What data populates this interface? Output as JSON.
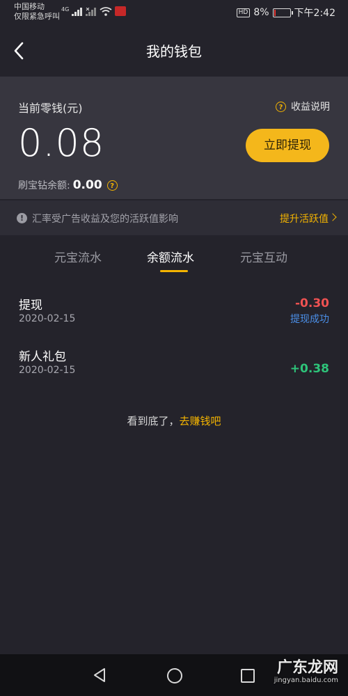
{
  "status_bar": {
    "carrier_line1": "中国移动",
    "carrier_line2": "仅限紧急呼叫",
    "network": "4G",
    "battery_percent": "8%",
    "battery_level": 0.08,
    "time": "下午2:42"
  },
  "header": {
    "title": "我的钱包"
  },
  "wallet": {
    "balance_label": "当前零钱(元)",
    "help_label": "收益说明",
    "balance": "0.08",
    "withdraw_label": "立即提现",
    "diamond_label": "刷宝钻余额:",
    "diamond_value": "0.00"
  },
  "notice": {
    "text": "汇率受广告收益及您的活跃值影响",
    "action": "提升活跃值"
  },
  "tabs": [
    {
      "label": "元宝流水",
      "active": false
    },
    {
      "label": "余额流水",
      "active": true
    },
    {
      "label": "元宝互动",
      "active": false
    }
  ],
  "records": [
    {
      "title": "提现",
      "date": "2020-02-15",
      "amount": "-0.30",
      "status": "提现成功"
    },
    {
      "title": "新人礼包",
      "date": "2020-02-15",
      "amount": "+0.38",
      "status": ""
    }
  ],
  "footer": {
    "end_text": "看到底了，",
    "end_link": "去赚钱吧"
  },
  "watermark": {
    "title": "广东龙网",
    "subtitle": "jingyan.baidu.com"
  },
  "colors": {
    "accent": "#f4b71b",
    "negative": "#f05252",
    "positive": "#2ec47a",
    "link_blue": "#4b8fe8"
  }
}
